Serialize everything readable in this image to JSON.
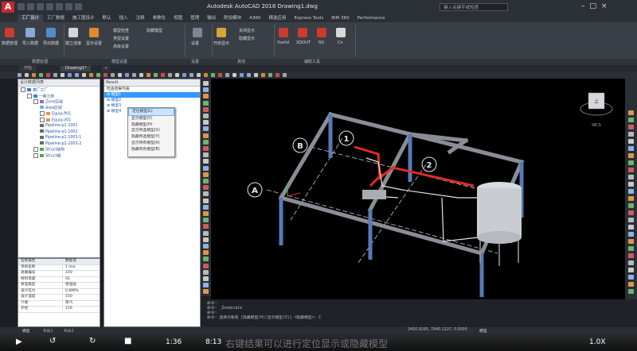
{
  "app": {
    "title": "Autodesk AutoCAD 2018   Drawing1.dwg",
    "search_placeholder": "键入关键字或短语",
    "logo": "A"
  },
  "ribbon_tabs": [
    "默认",
    "插入",
    "注释",
    "参数化",
    "视图",
    "管理",
    "输出",
    "附加模块",
    "A360",
    "精选应用",
    "Express Tools",
    "BIM 360",
    "Performance"
  ],
  "ribbon_tabs_active_index": 3,
  "ribbon_tabs_first": [
    "工厂设计",
    "工厂数据",
    "施工图设计"
  ],
  "ribbon": {
    "groups": [
      {
        "label": "数据处理",
        "buttons": [
          "数据管理",
          "导入数据",
          "导出数据"
        ]
      },
      {
        "label": "模型设置",
        "buttons": [
          "建立连接",
          "显示设置",
          "模型检查",
          "类型设置",
          "高级设置",
          "隐藏模型"
        ]
      },
      {
        "label": "设置",
        "buttons": [
          "设置"
        ]
      },
      {
        "label": "其他",
        "buttons": [
          "开启显示",
          "关闭显示",
          "隐藏显示"
        ]
      },
      {
        "label": "辅助工具",
        "buttons": [
          "Xsolid",
          "XDOUT",
          "NV",
          "Cn"
        ]
      }
    ]
  },
  "panel_labels": [
    "数据处理",
    "模型设置",
    "设置",
    "其他",
    "辅助工具"
  ],
  "file_tabs": [
    "开始",
    "Drawing1*"
  ],
  "tree": {
    "header": "设计数据列表",
    "items": [
      {
        "label": "某厂工厂",
        "level": 0,
        "toggle": true
      },
      {
        "label": "一期工程",
        "level": 1,
        "toggle": true
      },
      {
        "label": "Zone区域",
        "level": 2,
        "toggle": true
      },
      {
        "label": "Area区域",
        "level": 3,
        "toggle": false
      },
      {
        "label": "Equip-P01",
        "level": 3,
        "toggle": true
      },
      {
        "label": "Equip-V01",
        "level": 3,
        "toggle": true
      },
      {
        "label": "Pipeline-p1-1001",
        "level": 3,
        "toggle": false
      },
      {
        "label": "Pipeline-p1-1002",
        "level": 3,
        "toggle": false
      },
      {
        "label": "Pipeline-p1-1003-1",
        "level": 3,
        "toggle": false
      },
      {
        "label": "Pipeline-p1-1003-2",
        "level": 3,
        "toggle": false
      },
      {
        "label": "Struct结构",
        "level": 2,
        "toggle": true
      },
      {
        "label": "Struct钢",
        "level": 2,
        "toggle": true
      }
    ]
  },
  "props": {
    "header": [
      "名称属性",
      "数据值"
    ],
    "rows": [
      [
        "项目名称",
        "1 line"
      ],
      [
        "关联编号",
        "100"
      ],
      [
        "材料等级",
        "SS"
      ],
      [
        "保温类型",
        "保温层"
      ],
      [
        "设计压力",
        "0.6MPa"
      ],
      [
        "设计温度",
        "150"
      ],
      [
        "介质",
        "蒸汽"
      ],
      [
        "外径",
        "159"
      ]
    ]
  },
  "result": {
    "header": "Result",
    "subheader": "检查结果列表",
    "items": [
      "模型1",
      "模型2",
      "模型3",
      "模型4"
    ]
  },
  "context_menu": {
    "items": [
      "定位模型(L)",
      "显示模型(V)",
      "隐藏模型(H)",
      "显示所选模型(X)",
      "隐藏所选模型(Y)",
      "显示所有模型(A)",
      "隐藏所有模型(B)"
    ],
    "highlighted_index": 0
  },
  "viewport": {
    "grid_labels": [
      "A",
      "B",
      "1",
      "2"
    ],
    "viewcube": {
      "label": "上",
      "compass": "WCS"
    },
    "colors": {
      "column": "#5a79b4",
      "beam": "#8a8d93",
      "pipe_red": "#e12b26",
      "tank": "#c9ccd0"
    }
  },
  "command": {
    "lines": [
      "命令:",
      "命令: _Zoomscale",
      "命令:",
      "命令: 选择对象或 [隐藏模型(H)/显示模型(V)] <隐藏模型>: C"
    ]
  },
  "status": {
    "coords": "2450.9295, 7940.1227, 0.0000",
    "mode": "模型"
  },
  "layout_tabs": [
    "模型",
    "布局1",
    "布局2"
  ],
  "player": {
    "subtitle": "右键结果可以进行定位显示或隐藏模型",
    "time_current": "1:36",
    "time_total": "8:13",
    "speed": "1.0X"
  }
}
